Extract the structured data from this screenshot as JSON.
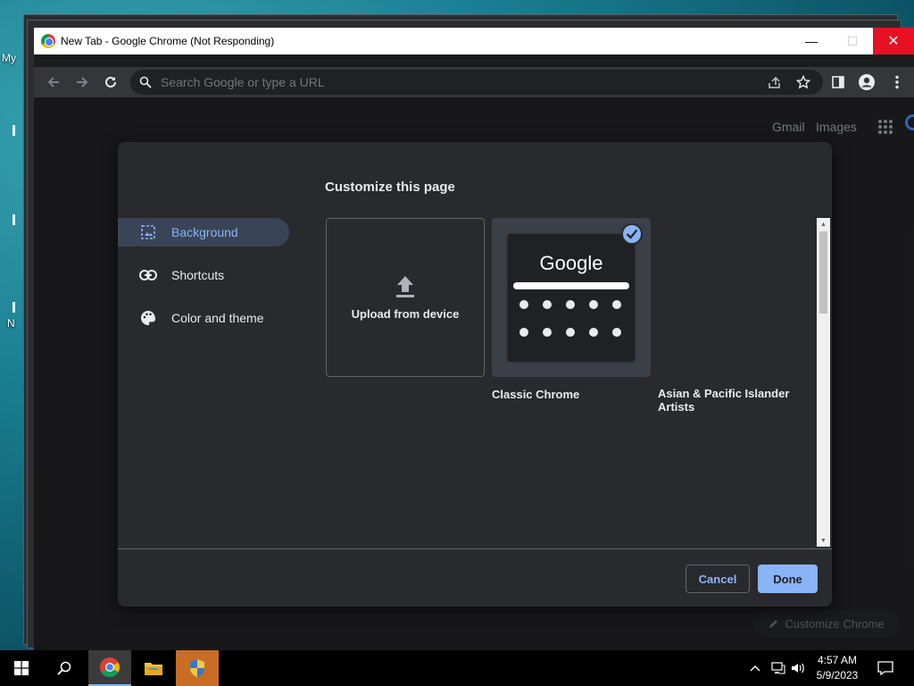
{
  "desktop": {
    "icon_label_fragments": [
      "My",
      "N"
    ]
  },
  "window": {
    "title": "New Tab - Google Chrome (Not Responding)",
    "minimize_glyph": "—",
    "maximize_glyph": "☐",
    "close_glyph": "✕"
  },
  "toolbar": {
    "omnibox_placeholder": "Search Google or type a URL"
  },
  "ntp": {
    "gmail_link": "Gmail",
    "images_link": "Images",
    "customize_button": "Customize Chrome"
  },
  "dialog": {
    "title": "Customize this page",
    "menu": [
      {
        "label": "Background",
        "icon": "image-icon",
        "selected": true
      },
      {
        "label": "Shortcuts",
        "icon": "link-icon",
        "selected": false
      },
      {
        "label": "Color and theme",
        "icon": "palette-icon",
        "selected": false
      }
    ],
    "tiles": {
      "upload_label": "Upload from device",
      "classic_preview_logo": "Google",
      "classic_caption": "Classic Chrome",
      "classic_selected": true,
      "artists_caption_line1": "Asian & Pacific Islander",
      "artists_caption_line2": "Artists"
    },
    "cancel_label": "Cancel",
    "done_label": "Done"
  },
  "taskbar": {
    "time": "4:57 AM",
    "date": "5/9/2023",
    "pinned": [
      "windows-start",
      "search",
      "chrome",
      "file-explorer",
      "security"
    ]
  },
  "colors": {
    "accent": "#8ab4f8",
    "dialog_bg": "#292a2d",
    "close_red": "#e81123"
  }
}
